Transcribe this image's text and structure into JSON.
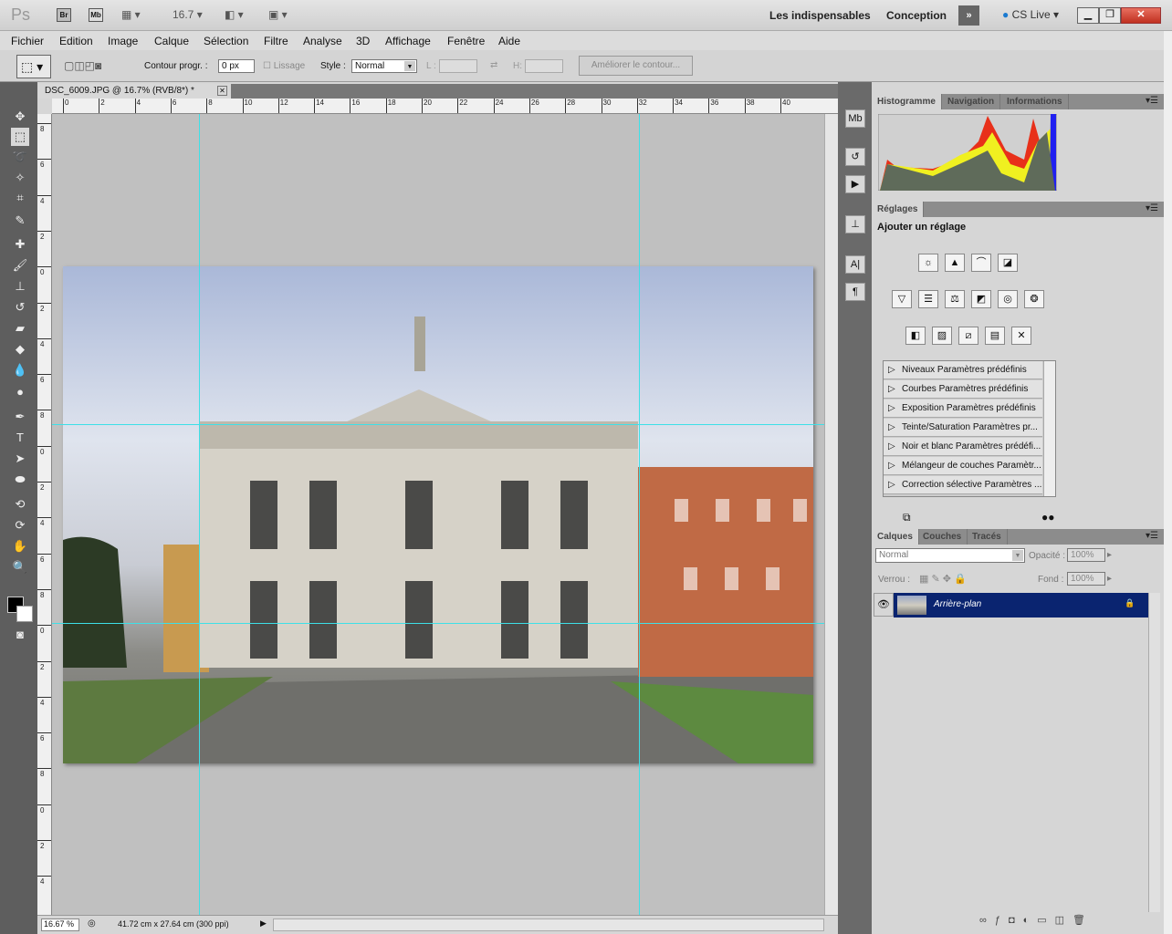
{
  "appbar": {
    "logo": "Ps",
    "bridge": "Br",
    "minibridge": "Mb",
    "zoom": "16.7",
    "workspaces": [
      "Les indispensables",
      "Conception"
    ],
    "cslive": "CS Live"
  },
  "menu": [
    "Fichier",
    "Edition",
    "Image",
    "Calque",
    "Sélection",
    "Filtre",
    "Analyse",
    "3D",
    "Affichage",
    "Fenêtre",
    "Aide"
  ],
  "options": {
    "feather_label": "Contour progr. :",
    "feather_value": "0 px",
    "antialias_label": "Lissage",
    "style_label": "Style :",
    "style_value": "Normal",
    "width_label": "L :",
    "height_label": "H:",
    "refine_button": "Améliorer le contour..."
  },
  "document": {
    "tab_title": "DSC_6009.JPG @ 16.7% (RVB/8*)",
    "zoom_status": "16.67 %",
    "doc_info": "41.72 cm x 27.64 cm (300 ppi)"
  },
  "rulers": {
    "horizontal": [
      "0",
      "2",
      "4",
      "6",
      "8",
      "10",
      "12",
      "14",
      "16",
      "18",
      "20",
      "22",
      "24",
      "26",
      "28",
      "30",
      "32",
      "34",
      "36",
      "38",
      "40"
    ],
    "vertical": [
      "8",
      "6",
      "4",
      "2",
      "0",
      "2",
      "4",
      "6",
      "8",
      "0",
      "2",
      "4",
      "6",
      "8",
      "0",
      "2",
      "4",
      "6",
      "8",
      "0",
      "2",
      "4"
    ]
  },
  "panels": {
    "histogram_tabs": [
      "Histogramme",
      "Navigation",
      "Informations"
    ],
    "adjustments_tab": "Réglages",
    "adjustments_title": "Ajouter un réglage",
    "presets": [
      "Niveaux Paramètres prédéfinis",
      "Courbes Paramètres prédéfinis",
      "Exposition Paramètres prédéfinis",
      "Teinte/Saturation Paramètres pr...",
      "Noir et blanc Paramètres prédéfi...",
      "Mélangeur de couches Paramètr...",
      "Correction sélective Paramètres ..."
    ],
    "layers_tabs": [
      "Calques",
      "Couches",
      "Tracés"
    ],
    "blend_mode": "Normal",
    "opacity_label": "Opacité :",
    "opacity_value": "100%",
    "lock_label": "Verrou :",
    "fill_label": "Fond :",
    "fill_value": "100%",
    "layers": [
      {
        "name": "Arrière-plan",
        "visible": true,
        "locked": true
      }
    ]
  },
  "colors": {
    "selected_layer": "#0a2470",
    "guide": "#3de0e8",
    "histogram_red": "#e8301a",
    "histogram_yellow": "#f0f020",
    "histogram_green": "#30e830",
    "histogram_blue": "#2020f0",
    "histogram_gray": "#5f6b5a"
  }
}
